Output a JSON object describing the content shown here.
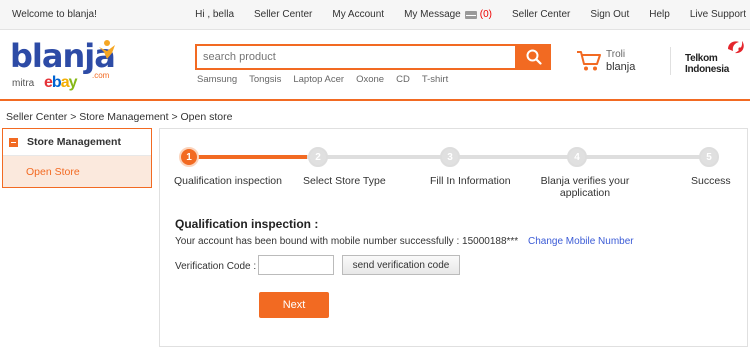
{
  "topbar": {
    "welcome": "Welcome to blanja!",
    "greeting": "Hi , bella",
    "seller_center": "Seller Center",
    "my_account": "My Account",
    "my_message": "My Message",
    "message_count": "(0)",
    "seller_center_2": "Seller Center",
    "sign_out": "Sign Out",
    "help": "Help",
    "live_support": "Live Support"
  },
  "header": {
    "logo": {
      "brand": "blanja",
      "mitra": "mitra",
      "ebay": "ebay",
      "com": ".com"
    },
    "search": {
      "placeholder": "search product"
    },
    "hotwords": [
      "Samsung",
      "Tongsis",
      "Laptop Acer",
      "Oxone",
      "CD",
      "T-shirt"
    ],
    "cart": {
      "line1": "Troli",
      "line2": "blanja"
    },
    "partner": {
      "line1": "Telkom",
      "line2": "Indonesia"
    }
  },
  "breadcrumb": "Seller Center > Store Management > Open store",
  "sidebar": {
    "heading": "Store Management",
    "items": [
      {
        "label": "Open Store"
      }
    ]
  },
  "steps": [
    {
      "num": "1",
      "label": "Qualification inspection"
    },
    {
      "num": "2",
      "label": "Select Store Type"
    },
    {
      "num": "3",
      "label": "Fill In Information"
    },
    {
      "num": "4",
      "label": "Blanja verifies your application"
    },
    {
      "num": "5",
      "label": "Success"
    }
  ],
  "form": {
    "title": "Qualification inspection :",
    "bound_text": "Your account has been bound with mobile number successfully : 15000188***",
    "change_link": "Change Mobile Number",
    "verification_label": "Verification Code :",
    "verification_value": "",
    "send_button": "send verification code",
    "next_button": "Next"
  },
  "colors": {
    "accent": "#f26a22",
    "brand_blue": "#2d4ba6",
    "link": "#3b5bd6"
  },
  "icons": {
    "search": "search-icon",
    "cart": "cart-icon",
    "mail": "mail-icon",
    "collapse": "minus-icon"
  }
}
